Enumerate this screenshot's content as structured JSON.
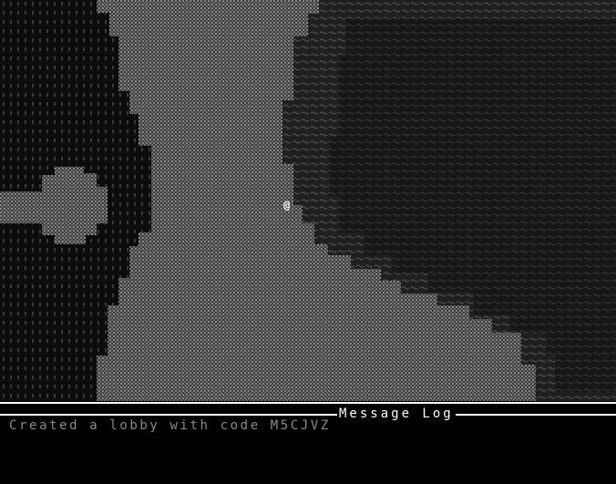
{
  "map": {
    "player_glyph": "@",
    "tiles": {
      "tree": {
        "glyph": "♠",
        "color": "#4a4a4a"
      },
      "grass": {
        "glyph": "▒",
        "color": "#6e6e6e"
      },
      "water": {
        "glyph": "~",
        "color": "#3e3e3e"
      }
    }
  },
  "message_log": {
    "title": "Message Log",
    "messages": [
      "Created a lobby with code M5CJVZ"
    ]
  },
  "colors": {
    "background": "#000000",
    "frame": "#ffffff",
    "message_text": "#8a8a8a"
  }
}
